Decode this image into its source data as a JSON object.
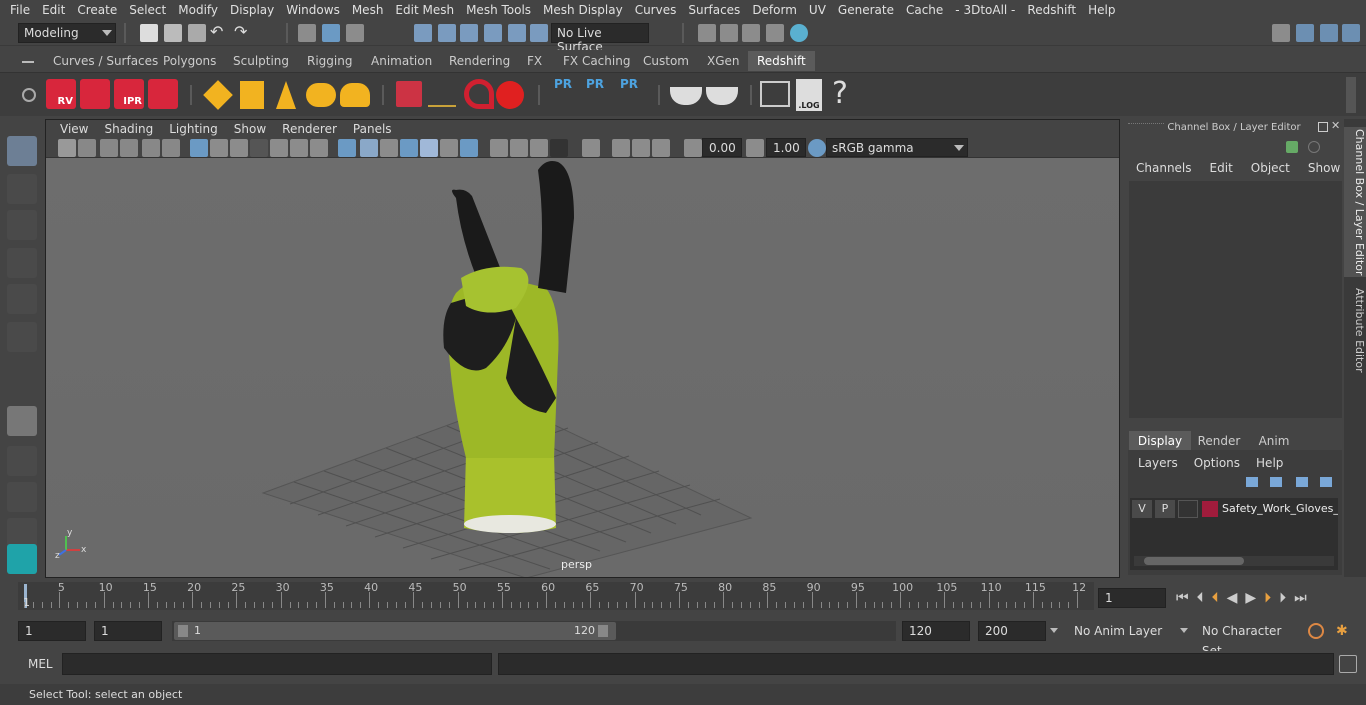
{
  "menu": [
    "File",
    "Edit",
    "Create",
    "Select",
    "Modify",
    "Display",
    "Windows",
    "Mesh",
    "Edit Mesh",
    "Mesh Tools",
    "Mesh Display",
    "Curves",
    "Surfaces",
    "Deform",
    "UV",
    "Generate",
    "Cache",
    "- 3DtoAll -",
    "Redshift",
    "Help"
  ],
  "status": {
    "mode": "Modeling",
    "live_surface": "No Live Surface"
  },
  "shelf_tabs": [
    "Curves / Surfaces",
    "Polygons",
    "Sculpting",
    "Rigging",
    "Animation",
    "Rendering",
    "FX",
    "FX Caching",
    "Custom",
    "XGen",
    "Redshift"
  ],
  "shelf_active": "Redshift",
  "shelf_icon_labels": {
    "rv": "RV",
    "ipr": "IPR",
    "pr": "PR",
    "log": ".LOG",
    "help": "?"
  },
  "panel_menu": [
    "View",
    "Shading",
    "Lighting",
    "Show",
    "Renderer",
    "Panels"
  ],
  "panel_tools": {
    "exposure": "0.00",
    "gamma": "1.00",
    "colorspace": "sRGB gamma"
  },
  "viewport": {
    "camera_label": "persp",
    "axis_x": "x",
    "axis_y": "y",
    "axis_z": "z"
  },
  "channel_box": {
    "title": "Channel Box / Layer Editor",
    "menus": [
      "Channels",
      "Edit",
      "Object",
      "Show"
    ]
  },
  "layer_editor": {
    "tabs": [
      "Display",
      "Render",
      "Anim"
    ],
    "active_tab": "Display",
    "menus": [
      "Layers",
      "Options",
      "Help"
    ],
    "layer": {
      "v": "V",
      "p": "P",
      "name": "Safety_Work_Gloves_S",
      "color": "#a01c3c"
    }
  },
  "side_tabs": [
    "Channel Box / Layer Editor",
    "Attribute Editor"
  ],
  "timeline": {
    "ticks": [
      "5",
      "10",
      "15",
      "20",
      "25",
      "30",
      "35",
      "40",
      "45",
      "50",
      "55",
      "60",
      "65",
      "70",
      "75",
      "80",
      "85",
      "90",
      "95",
      "100",
      "105",
      "110",
      "115",
      "12"
    ],
    "start_frame": "1",
    "current_frame": "1"
  },
  "range": {
    "start": "1",
    "start2": "1",
    "slider_start": "1",
    "slider_end": "120",
    "end": "120",
    "end2": "200",
    "anim_layer": "No Anim Layer",
    "char_set": "No Character Set"
  },
  "cmd": {
    "label": "MEL"
  },
  "help_line": "Select Tool: select an object"
}
